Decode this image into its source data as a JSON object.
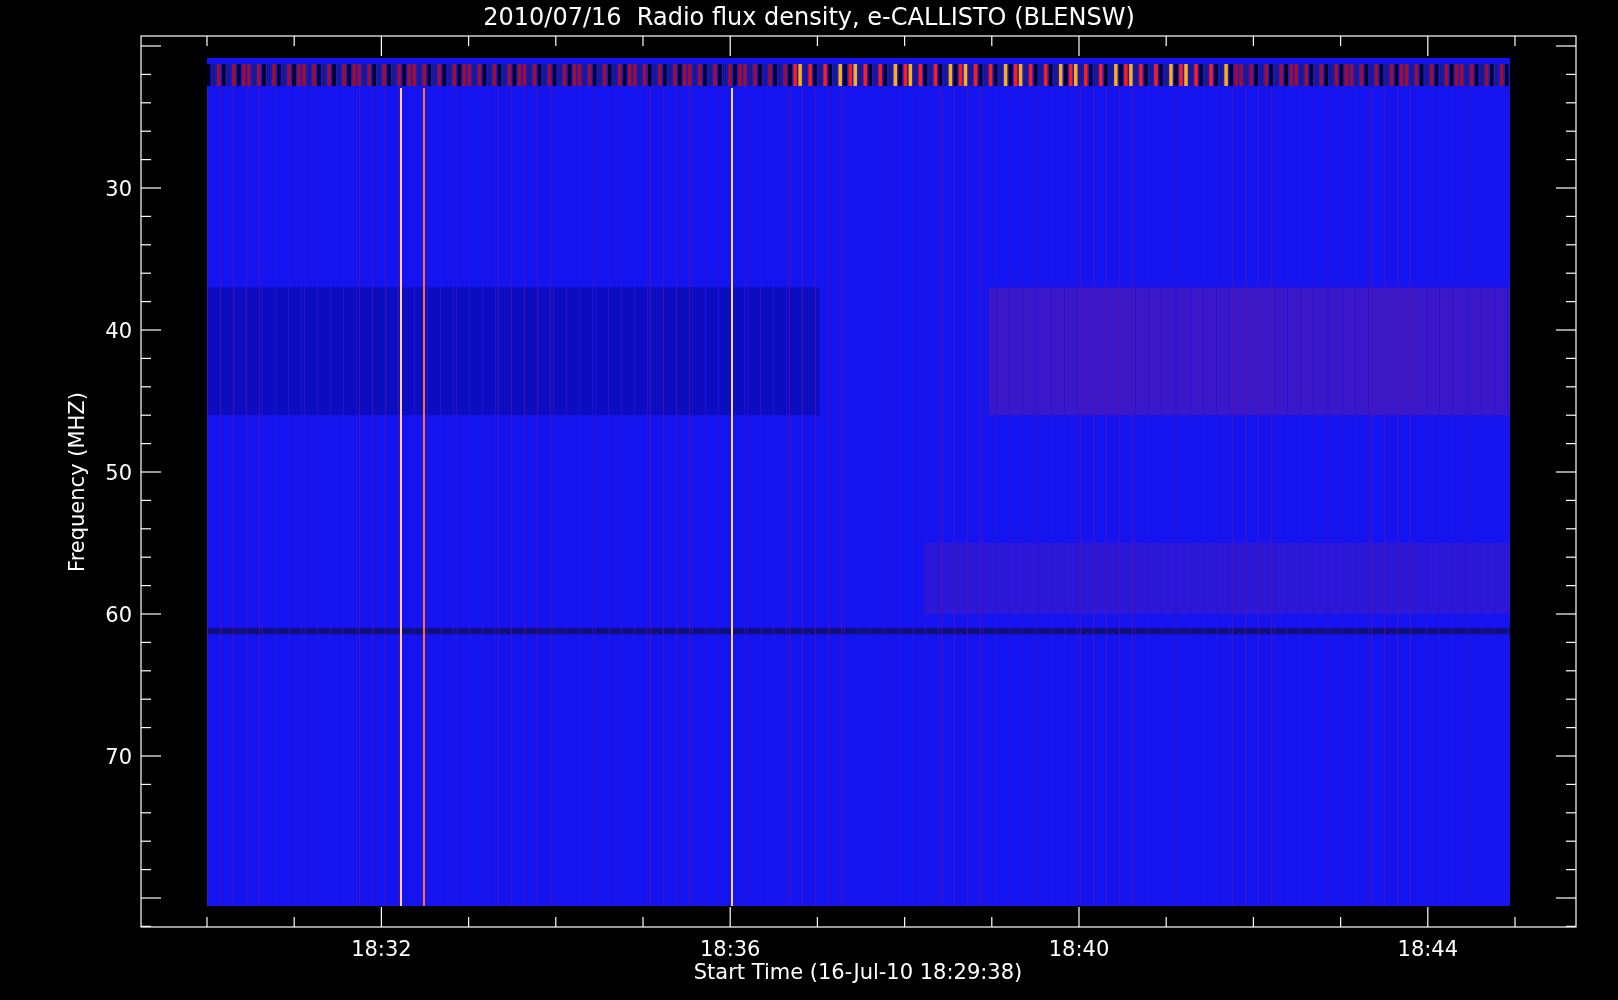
{
  "title": "2010/07/16  Radio flux density, e-CALLISTO (BLENSW)",
  "y_axis": {
    "label": "Frequency (MHZ)",
    "ticks": [
      "30",
      "40",
      "50",
      "60",
      "70"
    ]
  },
  "x_axis": {
    "label": "Start Time (16-Jul-10 18:29:38)",
    "ticks": [
      "18:32",
      "18:36",
      "18:40",
      "18:44"
    ]
  }
}
